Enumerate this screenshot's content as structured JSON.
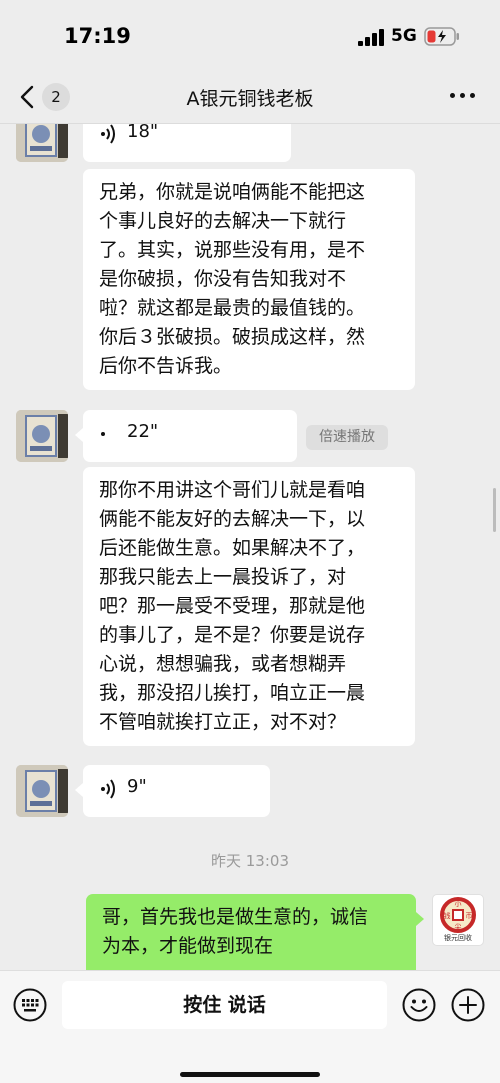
{
  "status_bar": {
    "time": "17:19",
    "network": "5G",
    "battery_color": "#e53935"
  },
  "nav": {
    "unread_count": "2",
    "title": "A银元铜钱老板",
    "back_icon": "chevron-left-icon",
    "more_icon": "more-dots-icon"
  },
  "messages": [
    {
      "id": "m1",
      "sender": "other",
      "type": "voice",
      "duration": "18\""
    },
    {
      "id": "m2",
      "sender": "other",
      "type": "text",
      "lines": [
        "兄弟，你就是说咱俩能不能把这",
        "个事儿良好的去解决一下就行",
        "了。其实，说那些没有用，是不",
        "是你破损，你没有告知我对不",
        "啦？就这都是最贵的最值钱的。",
        "你后３张破损。破损成这样，然",
        "后你不告诉我。"
      ]
    },
    {
      "id": "m3",
      "sender": "other",
      "type": "voice",
      "duration": "22\"",
      "speed_label": "倍速播放"
    },
    {
      "id": "m4",
      "sender": "other",
      "type": "text",
      "lines": [
        "那你不用讲这个哥们儿就是看咱",
        "俩能不能友好的去解决一下，以",
        "后还能做生意。如果解决不了，",
        "那我只能去上一晨投诉了，对",
        "吧？那一晨受不受理，那就是他",
        "的事儿了，是不是？你要是说存",
        "心说，想想骗我，或者想糊弄",
        "我，那没招儿挨打，咱立正一晨",
        "不管咱就挨打立正，对不对？"
      ]
    },
    {
      "id": "m5",
      "sender": "other",
      "type": "voice",
      "duration": "9\""
    },
    {
      "id": "t1",
      "type": "timestamp",
      "text": "昨天 13:03"
    },
    {
      "id": "m6",
      "sender": "me",
      "type": "text",
      "lines": [
        "哥，首先我也是做生意的，诚信",
        "为本，才能做到现在"
      ]
    }
  ],
  "my_avatar": {
    "logo_chars": [
      "小",
      "钱",
      "币",
      "尖"
    ],
    "caption": "银元回收",
    "ring_color": "#c62828"
  },
  "input_bar": {
    "hold_to_talk": "按住 说话",
    "keyboard_icon": "keyboard-icon",
    "emoji_icon": "emoji-icon",
    "plus_icon": "plus-icon"
  },
  "colors": {
    "background": "#ededed",
    "my_bubble": "#95ec69",
    "other_bubble": "#ffffff"
  }
}
